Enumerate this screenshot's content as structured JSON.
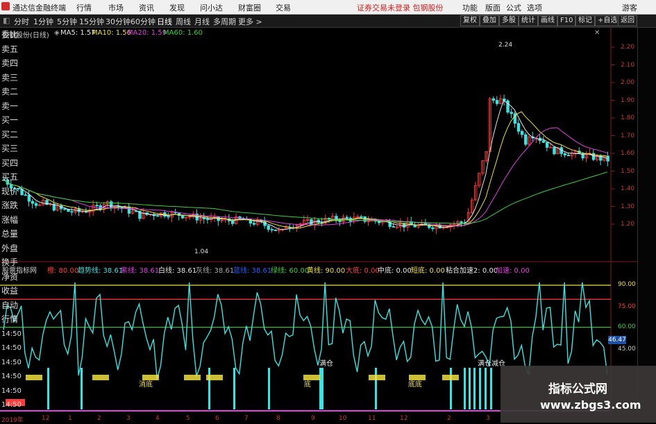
{
  "menubar": {
    "app_title": "通达信金融终端",
    "menus": [
      "行情",
      "市场",
      "资讯",
      "发现",
      "问小达",
      "财富圈",
      "交易"
    ],
    "notice": "证券交易未登录  包钢股份",
    "right_menus": [
      "功能",
      "版面",
      "公式",
      "选项"
    ],
    "guest": "游客"
  },
  "toolbar": {
    "periods": [
      "分时",
      "1分钟",
      "5分钟",
      "15分钟",
      "30分钟",
      "60分钟",
      "日线",
      "周线",
      "月线",
      "多周期",
      "更多 >"
    ],
    "active": "日线",
    "right_buttons": [
      "复权",
      "叠加",
      "多股",
      "统计",
      "画线",
      "F10",
      "标记",
      "+自选",
      "返回"
    ]
  },
  "price_pane": {
    "title": "包钢股份(日线)",
    "ma": [
      {
        "label": "MA5: 1.57",
        "color": "#e6e6e6"
      },
      {
        "label": "MA10: 1.56",
        "color": "#f0e040"
      },
      {
        "label": "MA20: 1.59",
        "color": "#e040e0"
      },
      {
        "label": "MA60: 1.60",
        "color": "#40d040"
      }
    ],
    "y_labels": [
      "2.20",
      "2.10",
      "2.00",
      "1.90",
      "1.80",
      "1.70",
      "1.60",
      "1.50",
      "1.40",
      "1.30",
      "1.20"
    ],
    "high_label": "2.24",
    "low_label": "1.04",
    "colors": {
      "up": "#ff3c3c",
      "down": "#40e0e0",
      "ma60": "#40d040"
    }
  },
  "indicator_pane": {
    "title": "股票指标网",
    "items": [
      {
        "label": "橙: 80.00",
        "color": "#ff3c3c"
      },
      {
        "label": "趋势线: 38.61",
        "color": "#40e0e0"
      },
      {
        "label": "紫线: 38.61",
        "color": "#e040e0"
      },
      {
        "label": "白线: 38.61",
        "color": "#e6e6e6"
      },
      {
        "label": "灰线: 38.61",
        "color": "#aaaaaa"
      },
      {
        "label": "蓝线: 38.61",
        "color": "#2060ff"
      },
      {
        "label": "绿线: 60.00",
        "color": "#40d040"
      },
      {
        "label": "黄线: 90.00",
        "color": "#f0e040"
      },
      {
        "label": "大底: 0.00",
        "color": "#ff3c3c"
      },
      {
        "label": "中底: 0.00",
        "color": "#e6e6e6"
      },
      {
        "label": "短底: 0.00",
        "color": "#f0e040"
      },
      {
        "label": "粘合加速2: 0.00",
        "color": "#e6e6e6"
      },
      {
        "label": "加速: 0.00",
        "color": "#e040e0"
      }
    ],
    "y_labels": [
      "90.00",
      "75.00",
      "60.00",
      "45.00"
    ],
    "current_value": "46.47",
    "texts": {
      "bottom": "底",
      "bottom2": "底底",
      "t1": "消底",
      "t2": "底",
      "t3": "底底",
      "t4": "满仓",
      "t5": "满仓减仓"
    }
  },
  "sidebar": {
    "items": [
      "委比",
      "卖五",
      "卖四",
      "卖三",
      "卖二",
      "卖一",
      "买一",
      "买二",
      "买三",
      "买四",
      "买五",
      "现价",
      "涨跌",
      "涨幅",
      "总量",
      "外盘",
      "换手",
      "净资",
      "收益",
      "自动",
      "行情",
      "14:50",
      "14:50",
      "14:50",
      "14:50",
      "14:50",
      "14:50"
    ]
  },
  "date_axis": [
    "2019年",
    "12",
    "1",
    "2",
    "3",
    "4",
    "5",
    "6",
    "7",
    "8",
    "9",
    "10",
    "11",
    "12",
    "2",
    "3"
  ],
  "watermark": {
    "title": "指标公式网",
    "url": "www.zbgs3.com"
  }
}
